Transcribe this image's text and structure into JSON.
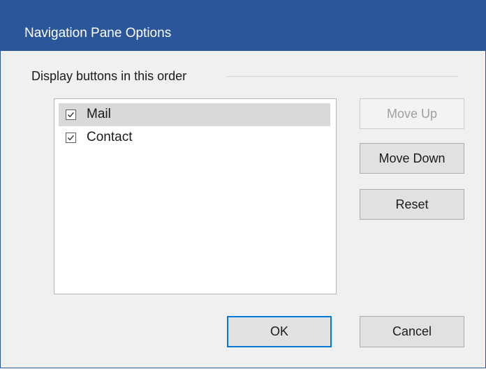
{
  "window": {
    "title": "Navigation Pane Options"
  },
  "group": {
    "label": "Display buttons in this order"
  },
  "list": {
    "items": [
      {
        "label": "Mail",
        "checked": true,
        "selected": true
      },
      {
        "label": "Contact",
        "checked": true,
        "selected": false
      }
    ]
  },
  "buttons": {
    "move_up": {
      "label": "Move Up",
      "enabled": false
    },
    "move_down": {
      "label": "Move Down",
      "enabled": true
    },
    "reset": {
      "label": "Reset",
      "enabled": true
    },
    "ok": {
      "label": "OK",
      "default": true
    },
    "cancel": {
      "label": "Cancel"
    }
  },
  "icons": {
    "checkbox_checked": "check-icon"
  },
  "colors": {
    "titlebar": "#2b579a",
    "dialog_bg": "#f0f0f0",
    "selection": "#d9d9d9",
    "default_button_border": "#0078d7",
    "disabled_text": "#a0a0a0"
  }
}
